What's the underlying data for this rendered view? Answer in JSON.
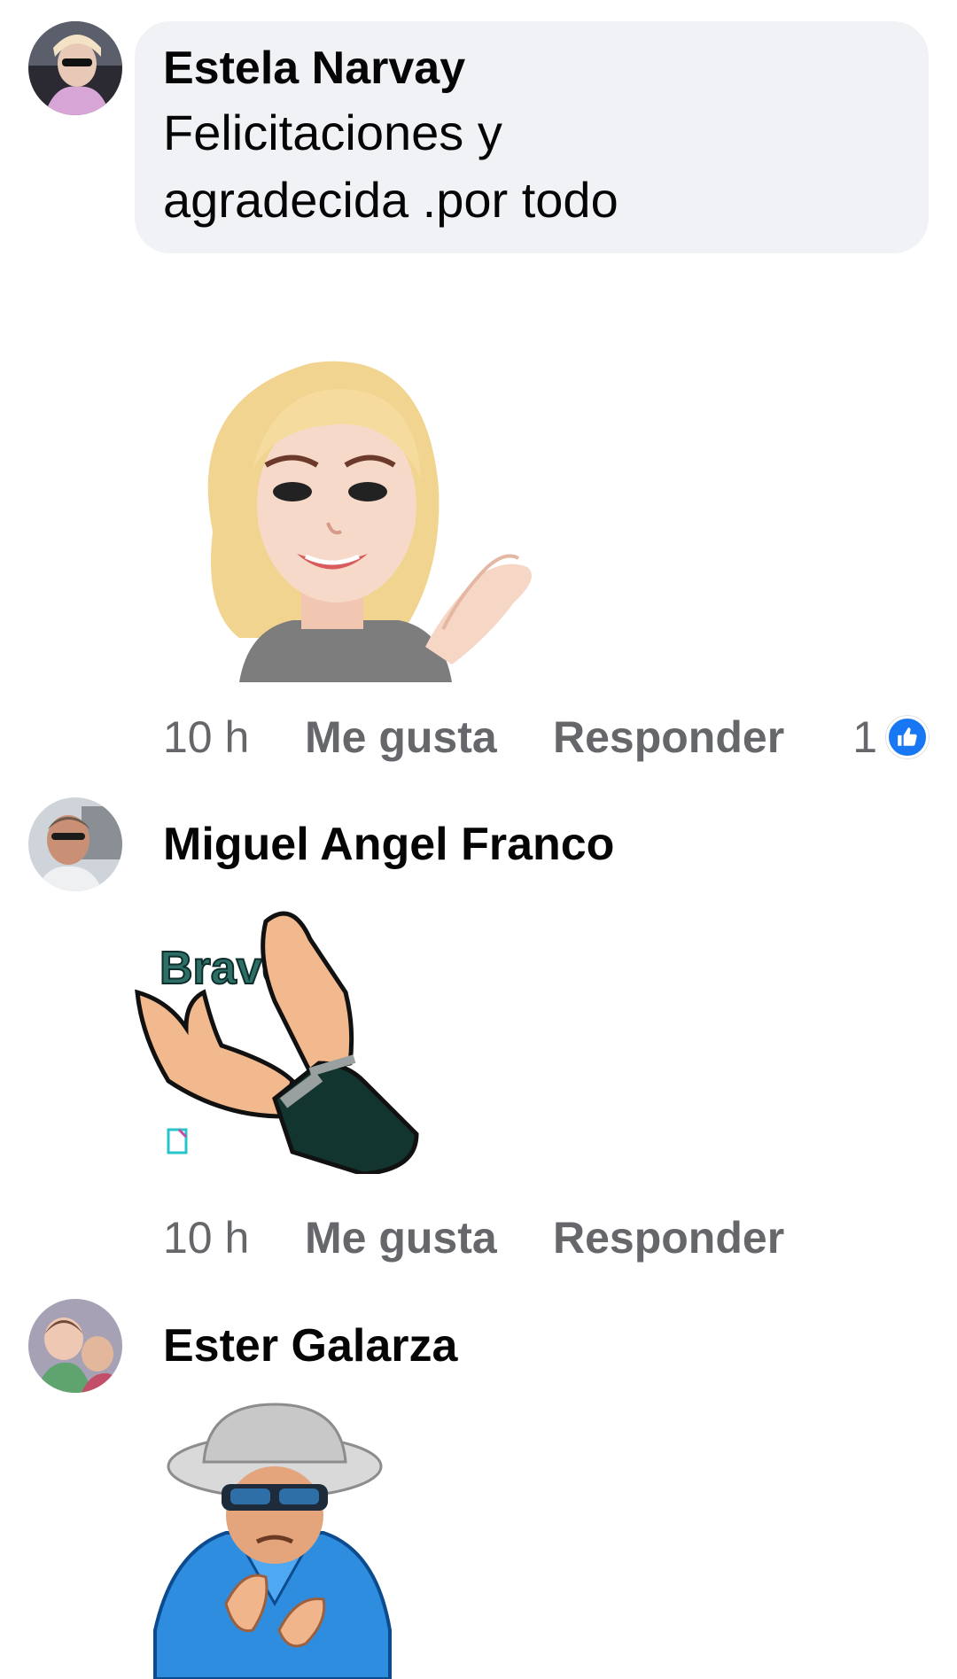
{
  "comments": [
    {
      "author": "Estela Narvay",
      "text_line1": "Felicitaciones y",
      "text_line2": "agradecida .por todo",
      "sticker": "woman-avatar-clapping-sticker",
      "time": "10 h",
      "like_label": "Me gusta",
      "reply_label": "Responder",
      "reaction_count": "1",
      "reaction_icon": "like-icon"
    },
    {
      "author": "Miguel Angel Franco",
      "sticker_text": "Bravo",
      "sticker": "clapping-hands-sticker",
      "time": "10 h",
      "like_label": "Me gusta",
      "reply_label": "Responder"
    },
    {
      "author": "Ester Galarza",
      "sticker": "man-in-hat-clapping-sticker"
    }
  ],
  "colors": {
    "bubble_bg": "#f0f2f5",
    "meta_text": "#65676b",
    "like_blue": "#1877f2"
  }
}
